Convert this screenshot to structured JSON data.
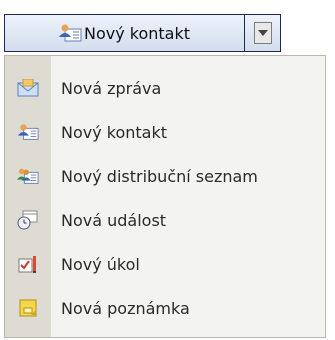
{
  "split_button": {
    "label": "Nový kontakt",
    "icon": "contact-card-icon"
  },
  "menu": {
    "items": [
      {
        "label": "Nová zpráva",
        "icon": "envelope-icon"
      },
      {
        "label": "Nový kontakt",
        "icon": "contact-card-icon"
      },
      {
        "label": "Nový distribuční seznam",
        "icon": "distribution-list-icon"
      },
      {
        "label": "Nová událost",
        "icon": "calendar-clock-icon"
      },
      {
        "label": "Nový úkol",
        "icon": "task-icon"
      },
      {
        "label": "Nová poznámka",
        "icon": "note-icon"
      }
    ]
  },
  "colors": {
    "button_border": "#1f2b4a",
    "menu_background": "#f3f3f1",
    "menu_gutter": "#dedbd2",
    "note_yellow": "#f5d84a",
    "envelope_blue": "#7aa3d8"
  }
}
